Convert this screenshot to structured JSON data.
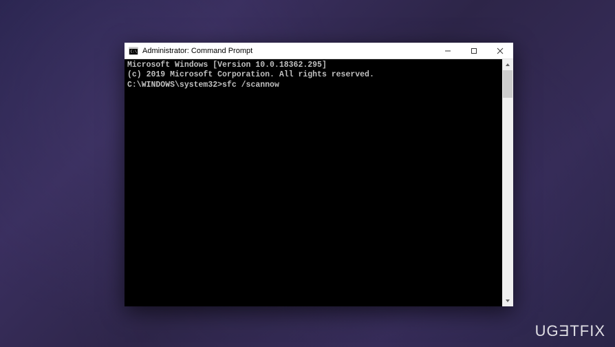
{
  "window": {
    "title": "Administrator: Command Prompt"
  },
  "terminal": {
    "line1": "Microsoft Windows [Version 10.0.18362.295]",
    "line2": "(c) 2019 Microsoft Corporation. All rights reserved.",
    "blank": "",
    "prompt": "C:\\WINDOWS\\system32>",
    "command": "sfc /scannow"
  },
  "watermark": {
    "text": "UGETFIX"
  }
}
